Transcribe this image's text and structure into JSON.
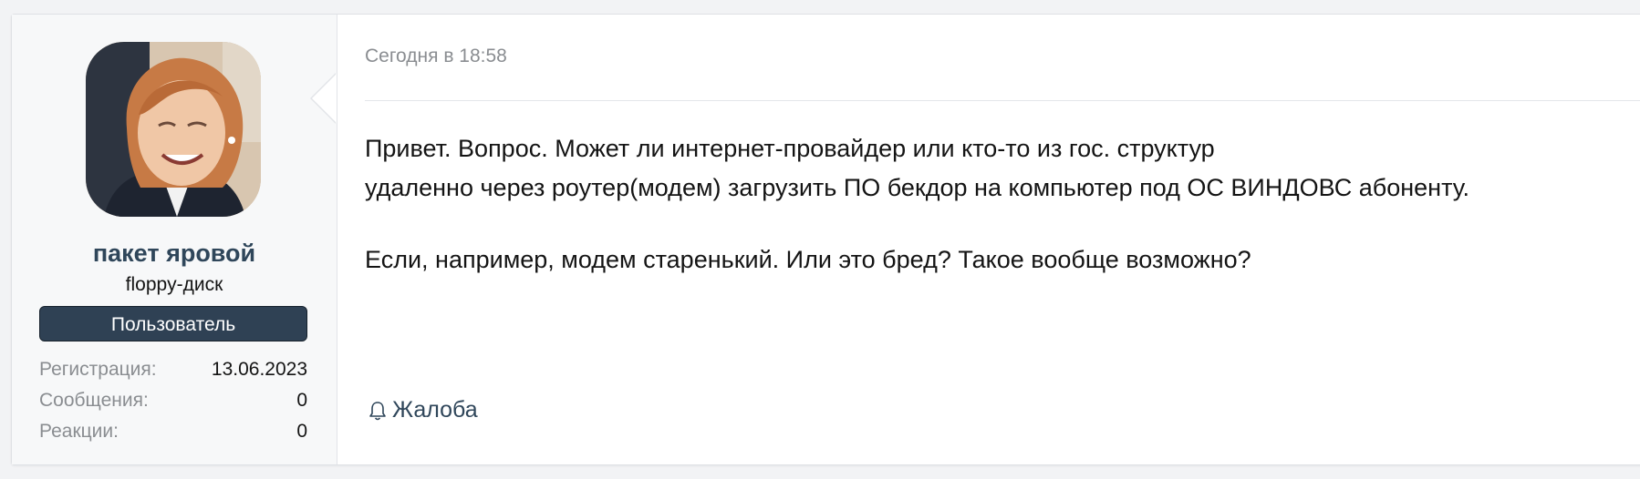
{
  "post": {
    "author": {
      "name": "пакет яровой",
      "title": "floppy-диск",
      "banner": "Пользователь",
      "stats": [
        {
          "label": "Регистрация:",
          "value": "13.06.2023"
        },
        {
          "label": "Сообщения:",
          "value": "0"
        },
        {
          "label": "Реакции:",
          "value": "0"
        }
      ]
    },
    "date": "Сегодня в 18:58",
    "body": {
      "line1": "Привет. Вопрос. Может ли интернет-провайдер или кто-то из гос. структур",
      "line2": "удаленно через роутер(модем) загрузить ПО бекдор на компьютер под ОС ВИНДОВС абоненту.",
      "line3": "Если, например, модем старенький. Или это бред? Такое вообще возможно?"
    },
    "actions": {
      "report_label": "Жалоба",
      "report_icon": "bell-icon"
    }
  },
  "colors": {
    "username": "#2f465a",
    "banner_bg": "#2f4154",
    "muted": "#8a8d91",
    "link": "#2f465a"
  }
}
